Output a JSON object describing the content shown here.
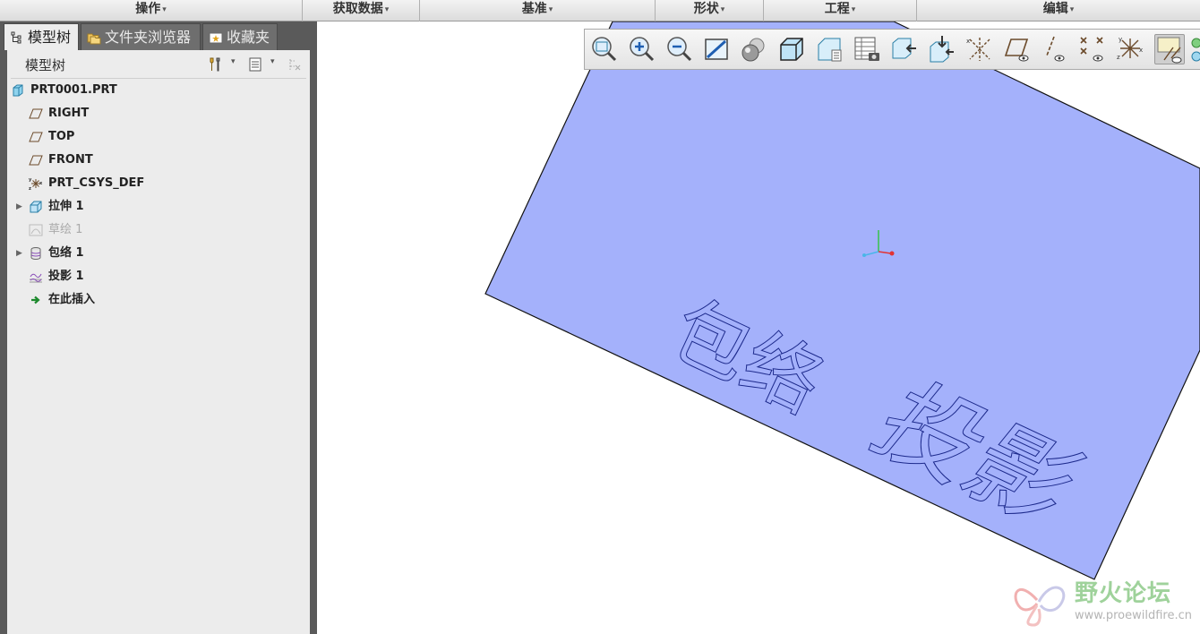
{
  "ribbon": {
    "groups": [
      "操作",
      "获取数据",
      "基准",
      "形状",
      "工程",
      "编辑"
    ]
  },
  "panel": {
    "tabs": [
      "模型树",
      "文件夹浏览器",
      "收藏夹"
    ],
    "tree_title": "模型树",
    "tree": [
      {
        "label": "PRT0001.PRT",
        "icon": "part-icon"
      },
      {
        "label": "RIGHT",
        "icon": "datum-plane-icon"
      },
      {
        "label": "TOP",
        "icon": "datum-plane-icon"
      },
      {
        "label": "FRONT",
        "icon": "datum-plane-icon"
      },
      {
        "label": "PRT_CSYS_DEF",
        "icon": "csys-icon"
      },
      {
        "label": "拉伸 1",
        "icon": "extrude-icon"
      },
      {
        "label": "草绘 1",
        "icon": "sketch-icon"
      },
      {
        "label": "包络 1",
        "icon": "wrap-icon"
      },
      {
        "label": "投影 1",
        "icon": "project-icon"
      },
      {
        "label": "在此插入",
        "icon": "insert-here-icon"
      }
    ]
  },
  "viewport": {
    "text_a": "包络",
    "text_b": "投影",
    "surface_color": "#a4b1fb"
  },
  "toolbar_icons": [
    "refit-icon",
    "zoom-in-icon",
    "zoom-out-icon",
    "repaint-icon",
    "appearance-icon",
    "display-style-icon",
    "saved-orientations-icon",
    "view-manager-icon",
    "perspective-icon",
    "section-icon",
    "annotation-display-icon",
    "datum-plane-display-icon",
    "datum-axis-display-icon",
    "datum-point-display-icon",
    "csys-display-icon",
    "spin-center-icon"
  ],
  "watermark": {
    "title": "野火论坛",
    "url": "www.proewildfire.cn"
  }
}
